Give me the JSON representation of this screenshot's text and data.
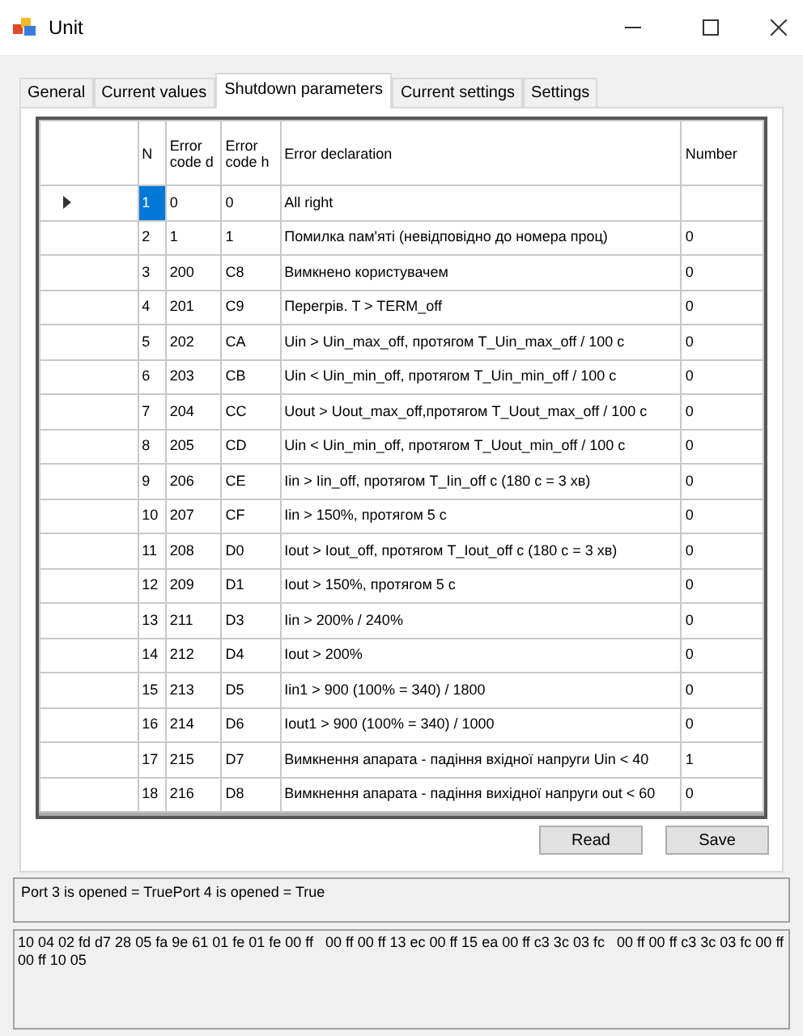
{
  "window": {
    "title": "Unit"
  },
  "tabs": [
    {
      "label": "General",
      "selected": false
    },
    {
      "label": "Current values",
      "selected": false
    },
    {
      "label": "Shutdown parameters",
      "selected": true
    },
    {
      "label": "Current settings",
      "selected": false
    },
    {
      "label": "Settings",
      "selected": false
    }
  ],
  "table": {
    "columns": [
      "N",
      "Error code d",
      "Error code h",
      "Error declaration",
      "Number"
    ],
    "rows": [
      {
        "n": "1",
        "code_d": "0",
        "code_h": "0",
        "declaration": "All right",
        "selected": true
      },
      {
        "n": "2",
        "code_d": "1",
        "code_h": "1",
        "declaration": "Помилка пам'яті (невідповідно до номера проц)",
        "number": "0",
        "selected": false
      },
      {
        "n": "3",
        "code_d": "200",
        "code_h": "C8",
        "declaration": "Вимкнено користувачем",
        "number": "0",
        "selected": false
      },
      {
        "n": "4",
        "code_d": "201",
        "code_h": "C9",
        "declaration": "Перегрів. T > TERM_off",
        "number": "0",
        "selected": false
      },
      {
        "n": "5",
        "code_d": "202",
        "code_h": "CA",
        "declaration": "Uin > Uin_max_off, протягом T_Uin_max_off / 100 c",
        "number": "0",
        "selected": false
      },
      {
        "n": "6",
        "code_d": "203",
        "code_h": "CB",
        "declaration": "Uin < Uin_min_off, протягом T_Uin_min_off / 100 c",
        "number": "0",
        "selected": false
      },
      {
        "n": "7",
        "code_d": "204",
        "code_h": "CC",
        "declaration": "Uout > Uout_max_off,протягом T_Uout_max_off / 100 c",
        "number": "0",
        "selected": false
      },
      {
        "n": "8",
        "code_d": "205",
        "code_h": "CD",
        "declaration": "Uin < Uin_min_off, протягом T_Uout_min_off / 100 c",
        "number": "0",
        "selected": false
      },
      {
        "n": "9",
        "code_d": "206",
        "code_h": "CE",
        "declaration": "Iin > Iin_off, протягом T_Iin_off c (180 c = 3 хв)",
        "number": "0",
        "selected": false
      },
      {
        "n": "10",
        "code_d": "207",
        "code_h": "CF",
        "declaration": "Iin > 150%, протягом 5 c",
        "number": "0",
        "selected": false
      },
      {
        "n": "11",
        "code_d": "208",
        "code_h": "D0",
        "declaration": "Iout > Iout_off, протягом T_Iout_off c (180 c = 3 хв)",
        "number": "0",
        "selected": false
      },
      {
        "n": "12",
        "code_d": "209",
        "code_h": "D1",
        "declaration": "Iout > 150%,  протягом 5 c",
        "number": "0",
        "selected": false
      },
      {
        "n": "13",
        "code_d": "211",
        "code_h": "D3",
        "declaration": "Iin > 200% / 240%",
        "number": "0",
        "selected": false
      },
      {
        "n": "14",
        "code_d": "212",
        "code_h": "D4",
        "declaration": "Iout > 200%",
        "number": "0",
        "selected": false
      },
      {
        "n": "15",
        "code_d": "213",
        "code_h": "D5",
        "declaration": "Iin1 > 900 (100% = 340) / 1800",
        "number": "0",
        "selected": false
      },
      {
        "n": "16",
        "code_d": "214",
        "code_h": "D6",
        "declaration": "Iout1 > 900 (100% = 340) / 1000",
        "number": "0",
        "selected": false
      },
      {
        "n": "17",
        "code_d": "215",
        "code_h": "D7",
        "declaration": "Вимкнення апарата - падіння вхідної напруги Uin < 40",
        "number": "1",
        "selected": false
      },
      {
        "n": "18",
        "code_d": "216",
        "code_h": "D8",
        "declaration": "Вимкнення апарата - падіння вихідної напруги out < 60",
        "number": "0",
        "selected": false
      }
    ]
  },
  "buttons": [
    "Read",
    "Save"
  ],
  "port_status": "Port 3 is opened = TruePort 4 is opened = True",
  "data_log": "10 04 02 fd d7 28 05 fa 9e 61 01 fe 01 fe 00 ff   00 ff 00 ff 13 ec 00 ff 15 ea 00 ff c3 3c 03 fc   00 ff 00 ff c3 3c 03 fc 00 ff 00 ff 10 05"
}
